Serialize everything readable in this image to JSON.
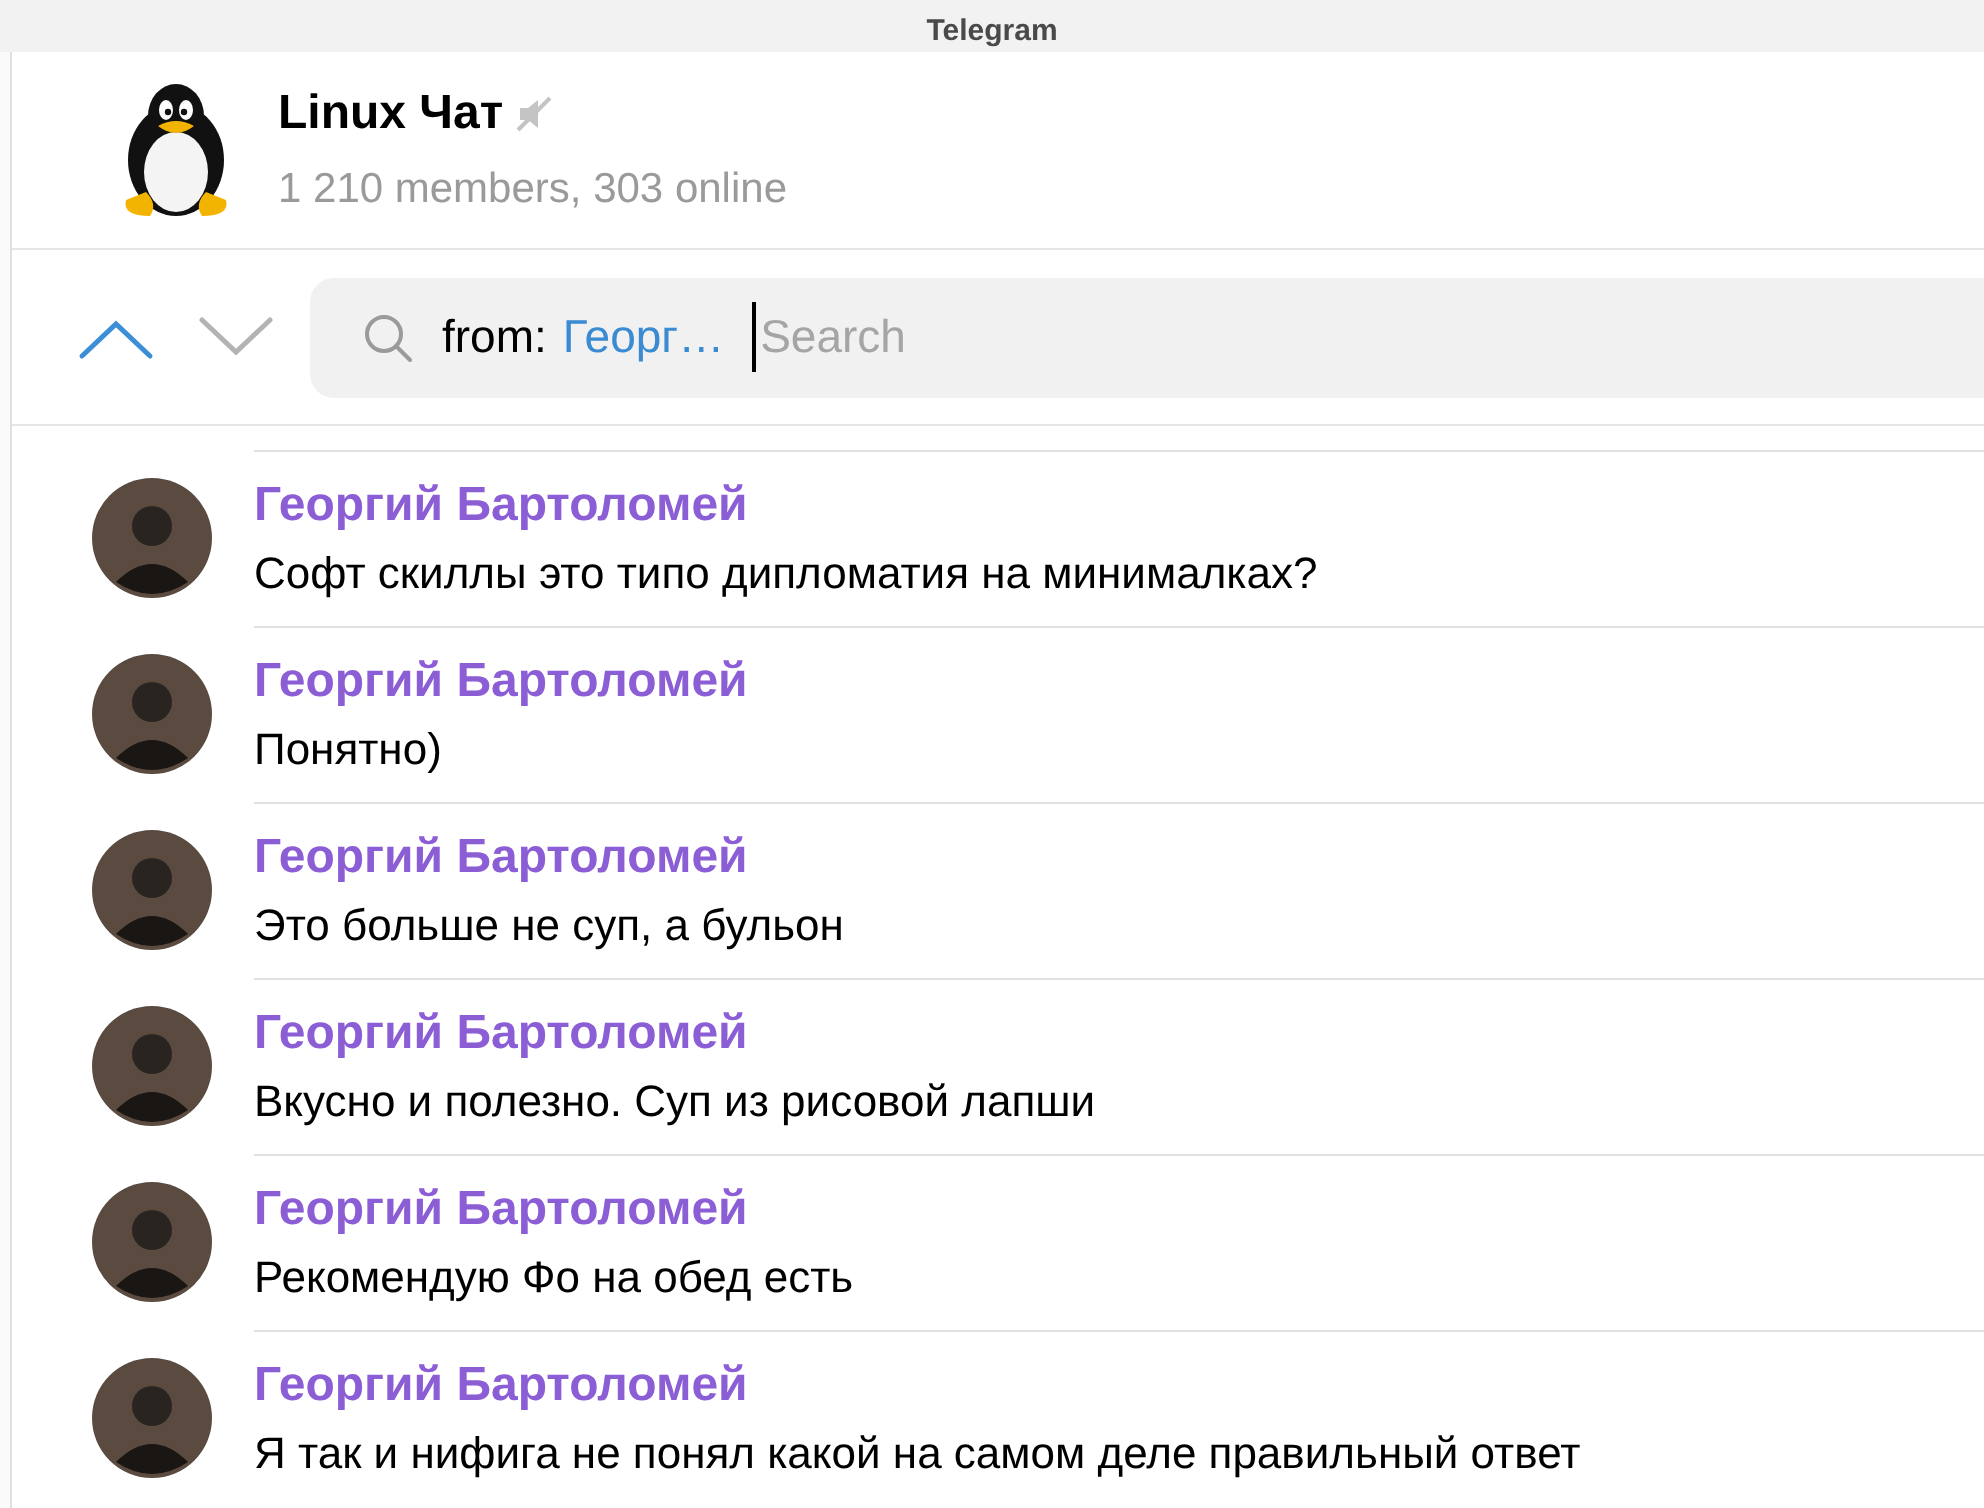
{
  "window": {
    "title": "Telegram"
  },
  "chat": {
    "title": "Linux Чат",
    "muted": true,
    "subtitle": "1 210 members, 303 online"
  },
  "search": {
    "filter_label": "from:",
    "filter_value": "Георг…",
    "placeholder": "Search",
    "up_enabled": true,
    "down_enabled": false
  },
  "messages": [
    {
      "author": "Георгий Бартоломей",
      "text": "Софт скиллы это типо дипломатия на минималках?"
    },
    {
      "author": "Георгий Бартоломей",
      "text": "Понятно)"
    },
    {
      "author": "Георгий Бартоломей",
      "text": "Это больше не суп, а бульон"
    },
    {
      "author": "Георгий Бартоломей",
      "text": "Вкусно и полезно. Суп из рисовой лапши"
    },
    {
      "author": "Георгий Бартоломей",
      "text": "Рекомендую Фо на обед есть"
    },
    {
      "author": "Георгий Бартоломей",
      "text": "Я так и нифига не понял какой на самом деле правильный ответ"
    }
  ]
}
